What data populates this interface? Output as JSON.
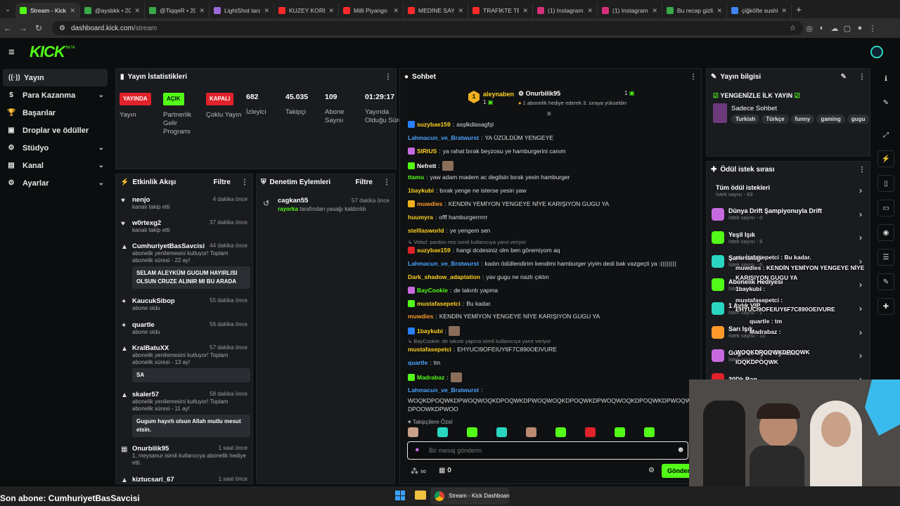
{
  "browser": {
    "tabs": [
      {
        "title": "Stream - Kick Da",
        "color": "#53fc18",
        "active": true
      },
      {
        "title": "@aysbkk • 20",
        "color": "#3aa84a"
      },
      {
        "title": "@TiqqeR • 20",
        "color": "#3aa84a"
      },
      {
        "title": "LightShot tara",
        "color": "#9a6ad8"
      },
      {
        "title": "KUZEY KORE T",
        "color": "#ff2a2a"
      },
      {
        "title": "Milli Piyango",
        "color": "#ff2a2a"
      },
      {
        "title": "MEDİNE SAYA",
        "color": "#ff2a2a"
      },
      {
        "title": "TRAFİKTE TEH",
        "color": "#ff2a2a"
      },
      {
        "title": "(1) Instagram",
        "color": "#d6307a"
      },
      {
        "title": "(1) Instagram",
        "color": "#d6307a"
      },
      {
        "title": "Bu recap gizli",
        "color": "#3aa84a"
      },
      {
        "title": "çiğköfte sushi",
        "color": "#4285f4"
      }
    ],
    "url_host": "dashboard.kick.com",
    "url_path": "/stream"
  },
  "app": {
    "logo": "KICK",
    "beta": "BETA"
  },
  "nav": [
    {
      "label": "Yayın",
      "icon": "broadcast-icon",
      "glyph": "((·))",
      "active": true,
      "chev": false
    },
    {
      "label": "Para Kazanma",
      "icon": "money-icon",
      "glyph": "$",
      "chev": true
    },
    {
      "label": "Başarılar",
      "icon": "trophy-icon",
      "glyph": "🏆",
      "chev": false
    },
    {
      "label": "Droplar ve ödüller",
      "icon": "gift-icon",
      "glyph": "▣",
      "chev": false
    },
    {
      "label": "Stüdyo",
      "icon": "gear-icon",
      "glyph": "⚙",
      "chev": true
    },
    {
      "label": "Kanal",
      "icon": "channel-icon",
      "glyph": "▤",
      "chev": true
    },
    {
      "label": "Ayarlar",
      "icon": "settings-icon",
      "glyph": "⚙",
      "chev": true
    }
  ],
  "stats": {
    "title": "Yayın İstatistikleri",
    "items": [
      {
        "badge": "YAYINDA",
        "badge_color": "#e0222a",
        "label": "Yayın"
      },
      {
        "badge": "AÇIK",
        "badge_color": "#53fc18",
        "label": "Partnerlik Gelir Programı"
      },
      {
        "badge": "KAPALI",
        "badge_color": "#e0222a",
        "label": "Çoklu Yayın"
      },
      {
        "value": "682",
        "label": "İzleyici"
      },
      {
        "value": "45.035",
        "label": "Takipçi"
      },
      {
        "value": "109",
        "label": "Abone Sayısı"
      },
      {
        "value": "01:29:17",
        "label": "Yayında Olduğu Süre"
      }
    ]
  },
  "activity": {
    "title": "Etkinlik Akışı",
    "filter": "Filtre",
    "items": [
      {
        "name": "nenjo",
        "time": "4 dakika önce",
        "sub": "kanalı takip etti",
        "icon": "♥"
      },
      {
        "name": "w0rtexg2",
        "time": "37 dakika önce",
        "sub": "kanalı takip etti",
        "icon": "♥"
      },
      {
        "name": "CumhuriyetBasSavcisi",
        "time": "44 dakika önce",
        "sub": "abonelik yenilemesini kutluyor! Toplam abonelik süresi - 22 ay!",
        "msg": "SELAM ALEYKÜM GUGUM HAYIRLISI OLSUN CRUZE ALINIR MI BU ARADA",
        "icon": "▲"
      },
      {
        "name": "KaucukSibop",
        "time": "55 dakika önce",
        "sub": "abone oldu",
        "icon": "✦"
      },
      {
        "name": "quartle",
        "time": "56 dakika önce",
        "sub": "abone oldu",
        "icon": "✦"
      },
      {
        "name": "KralBatuXX",
        "time": "57 dakika önce",
        "sub": "abonelik yenilemesini kutluyor! Toplam abonelik süresi - 13 ay!",
        "msg": "SA",
        "icon": "▲"
      },
      {
        "name": "skaler57",
        "time": "58 dakika önce",
        "sub": "abonelik yenilemesini kutluyor! Toplam abonelik süresi - 11 ay!",
        "msg": "Gugum hayırlı olsun Allah mutlu mesut etsin.",
        "icon": "▲"
      },
      {
        "name": "Onurbilik95",
        "time": "1 saat önce",
        "sub": "1, meysanur isimli kullanıcıya abonelik hediye etti.",
        "icon": "▦"
      },
      {
        "name": "kiztucsari_67",
        "time": "1 saat önce",
        "sub": "",
        "icon": "▲"
      }
    ]
  },
  "moderation": {
    "title": "Denetim Eylemleri",
    "filter": "Filtre",
    "items": [
      {
        "name": "cagkan55",
        "time": "57 dakika önce",
        "actor": "rayorka",
        "text": "tarafından yasağı kaldırıldı"
      }
    ]
  },
  "chat": {
    "title": "Sohbet",
    "pinned": {
      "top_user": "aleynaben",
      "top_count": "1",
      "gifter": "Onurbilik95",
      "gift_count": "1",
      "gift_text": "1 abonelik hediye ederek 3. sıraya yükseldin"
    },
    "messages": [
      {
        "user": "suzybae159",
        "color": "#ffd21f",
        "text": "asşlkdlasagfşl"
      },
      {
        "user": "Lahmacun_ve_Bratwurst",
        "color": "#4aa3ff",
        "text": "YA ÜZÜLDÜM YENGEYE"
      },
      {
        "user": "SIRIUS",
        "color": "#ffd21f",
        "text": "ya rahat bırak beyzosu ye hamburgerini canım"
      },
      {
        "user": "Nefrett",
        "color": "#ffffff",
        "text": ""
      },
      {
        "user": "ttamu",
        "color": "#53fc18",
        "text": "yaw adam madem ac degilsin bırak yesin hamburger"
      },
      {
        "user": "1baykubi",
        "color": "#ffd21f",
        "text": "bırak yenge ne isterse yesin yaw"
      },
      {
        "user": "muwdies",
        "color": "#ff9a2a",
        "text": "KENDİN YEMİYON YENGEYE NİYE KARIŞIYON GUGU YA"
      },
      {
        "user": "huumyra",
        "color": "#ffd21f",
        "text": "offf hamburgerrrrrr"
      },
      {
        "user": "stelllasworld",
        "color": "#ffd21f",
        "text": "ye yengem sen"
      },
      {
        "user": "suzybae159",
        "color": "#ffd21f",
        "text": "hangi dcdesiniz olm ben göremiyom aq",
        "reply": "Vebol: pardon reis isimli kullanıcıya yanıt veriyor"
      },
      {
        "user": "Lahmacun_ve_Bratwurst",
        "color": "#4aa3ff",
        "text": "kadın ödüllendirim kendimi hamburger yiyim dedi bak vazgeçti ya :(((((((("
      },
      {
        "user": "Dark_shadow_adaptation",
        "color": "#ffd21f",
        "text": "yav gugu ne nazlı çıktın"
      },
      {
        "user": "BayCookie",
        "color": "#53fc18",
        "text": "de takıntı yapma"
      },
      {
        "user": "mustafasepetci",
        "color": "#ffd21f",
        "text": "Bu kadar."
      },
      {
        "user": "muwdies",
        "color": "#ff9a2a",
        "text": "KENDİN YEMİYON YENGEYE NİYE KARIŞIYON GUGU YA"
      },
      {
        "user": "1baykubi",
        "color": "#ffd21f",
        "text": ""
      },
      {
        "user": "mustafasepetci",
        "color": "#ffd21f",
        "text": "EHYUCI9OFEIUY6F7C890OEIVURE",
        "reply": "BayCookie: de takıntı yapma isimli kullanıcıya yanıt veriyor"
      },
      {
        "user": "quartle",
        "color": "#4aa3ff",
        "text": "tm"
      },
      {
        "user": "Madrabaz",
        "color": "#53fc18",
        "text": ""
      },
      {
        "user": "Lahmacun_ve_Bratwurst",
        "color": "#4aa3ff",
        "text": "WOQKDPOQWKDPWOQWOQKDPOQWKDPWOQWOQKDPOQWKDPWOQWOQKDPOQWKDPWOQWOQKDPOQWKDPWOQ DPOQWKDPWOQ"
      }
    ],
    "followers_only": "Takipçilere Özel",
    "input_placeholder": "Bir mesaj gönderin",
    "send_label": "Gönder",
    "points": "∞",
    "gift_count": "0"
  },
  "stream_info": {
    "title": "Yayın bilgisi",
    "stream_title": "YENGENİZLE İLK YAYIN",
    "category": "Sadece Sohbet",
    "tags": [
      "Turkish",
      "Türkçe",
      "funny",
      "gaming",
      "gugu"
    ]
  },
  "rewards": {
    "title": "Ödül istek sırası",
    "items": [
      {
        "name": "Tüm ödül istekleri",
        "count": "İstek sayısı - 83",
        "color": ""
      },
      {
        "name": "Dünya Drift Şampiyonuyla Drift",
        "count": "İstek sayısı - 0",
        "color": "#c86adf"
      },
      {
        "name": "Yeşil Işık",
        "count": "İstek sayısı - 9",
        "color": "#53fc18"
      },
      {
        "name": "Şarkı İsteği",
        "count": "İstek sayısı - 6",
        "color": "#2ad6c0"
      },
      {
        "name": "Abonelik Hediyesi",
        "count": "İstek sayısı - 3",
        "color": "#53fc18"
      },
      {
        "name": "1 Aylık VIP",
        "count": "İstek sayısı - 2",
        "color": "#2ad6c0"
      },
      {
        "name": "Sarı Işık",
        "count": "İstek sayısı - 10",
        "color": "#ff9a2a"
      },
      {
        "name": "Gugu ile Oyun Oynatur",
        "count": "İstek sayısı - 5",
        "color": "#c86adf"
      },
      {
        "name": "30Dk Ban",
        "count": "",
        "color": "#e0222a"
      }
    ]
  },
  "overlay": {
    "lines": [
      "mustafasepetci : Bu kadar.",
      "muwdies : KENDİN YEMİYON YENGEYE NİYE",
      "KARIŞIYON GUGU YA",
      "1baykubi :",
      "mustafasepetci :",
      "EHYUCI9OFEIUY6F7C890OEIVURE",
      "quartle : tm",
      "Madrabaz :",
      "WOQKDPOQWKDPOQWK",
      "IOQKDPOQWK"
    ]
  },
  "taskbar": {
    "app_title": "Stream - Kick Dashboan",
    "last_sub": "Son abone: CumhuriyetBasSavcisi"
  },
  "rail_icons": [
    "info-icon",
    "pencil-icon",
    "expand-icon",
    "lightning-icon",
    "phone-icon",
    "chat-icon",
    "broadcast-icon",
    "server-icon",
    "wrench-icon",
    "connect-icon"
  ]
}
